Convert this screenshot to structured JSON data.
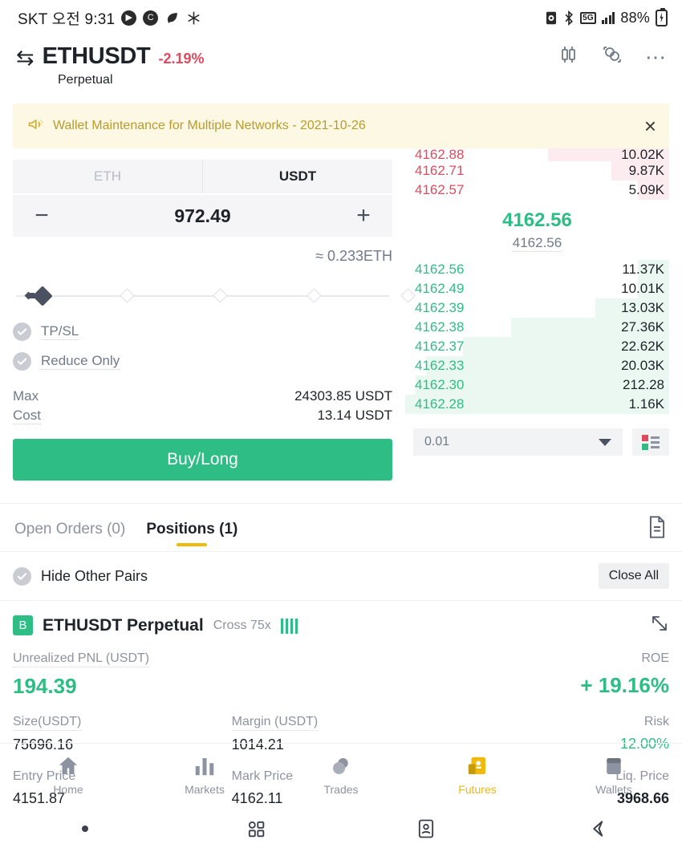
{
  "statusbar": {
    "carrier_time": "SKT 오전 9:31",
    "battery_percent": "88%",
    "network": "5G"
  },
  "header": {
    "swap_icon": "swap-icon",
    "pair": "ETHUSDT",
    "change": "-2.19%",
    "change_color": "#e04a5f",
    "subtitle": "Perpetual",
    "icons": [
      "candlestick-chart-icon",
      "orderbook-depth-icon",
      "more-options-icon"
    ]
  },
  "banner": {
    "icon": "announcement-icon",
    "text": "Wallet Maintenance for Multiple Networks - 2021-10-26",
    "close_label": "×",
    "bg_color": "#fdf8e3",
    "text_color": "#b99b2d"
  },
  "order_form": {
    "currency_tabs": [
      {
        "label": "ETH",
        "active": false
      },
      {
        "label": "USDT",
        "active": true
      }
    ],
    "minus_label": "−",
    "plus_label": "+",
    "quantity": "972.49",
    "approx": "≈ 0.233ETH",
    "slider_percent": 6,
    "checkboxes": [
      {
        "label": "TP/SL",
        "checked": true
      },
      {
        "label": "Reduce Only",
        "checked": true
      }
    ],
    "summary": [
      {
        "label": "Max",
        "value": "24303.85 USDT"
      },
      {
        "label": "Cost",
        "value": "13.14 USDT"
      }
    ],
    "submit_label": "Buy/Long",
    "submit_color": "#2ebd85"
  },
  "orderbook": {
    "asks": [
      {
        "price": "4162.88",
        "size": "10.02K",
        "depth": 46,
        "clipped": true
      },
      {
        "price": "4162.71",
        "size": "9.87K",
        "depth": 22
      },
      {
        "price": "4162.57",
        "size": "5.09K",
        "depth": 12
      }
    ],
    "mid_price": "4162.56",
    "mark_price": "4162.56",
    "bids": [
      {
        "price": "4162.56",
        "size": "11.37K",
        "depth": 12
      },
      {
        "price": "4162.49",
        "size": "10.01K",
        "depth": 12
      },
      {
        "price": "4162.39",
        "size": "13.03K",
        "depth": 28
      },
      {
        "price": "4162.38",
        "size": "27.36K",
        "depth": 60
      },
      {
        "price": "4162.37",
        "size": "22.62K",
        "depth": 78
      },
      {
        "price": "4162.33",
        "size": "20.03K",
        "depth": 92
      },
      {
        "price": "4162.30",
        "size": "212.28",
        "depth": 96
      },
      {
        "price": "4162.28",
        "size": "1.16K",
        "depth": 100
      }
    ],
    "tick_size": "0.01",
    "layout_icon": "orderbook-layout-icon",
    "ask_color": "#e04a5f",
    "bid_color": "#2ebd85"
  },
  "tabs": {
    "items": [
      {
        "label": "Open Orders (0)",
        "active": false
      },
      {
        "label": "Positions (1)",
        "active": true
      }
    ],
    "doc_icon": "order-history-icon",
    "indicator_color": "#f0b90b"
  },
  "hidebar": {
    "checkbox_label": "Hide Other Pairs",
    "checked": true,
    "close_all_label": "Close All"
  },
  "position": {
    "badge": "B",
    "title": "ETHUSDT Perpetual",
    "leverage": "Cross 75x",
    "risk_bars": 4,
    "external_icon": "open-external-icon",
    "pnl_label": "Unrealized PNL (USDT)",
    "pnl_value": "194.39",
    "roe_label": "ROE",
    "roe_value": "+ 19.16%",
    "fields": [
      {
        "label": "Size(USDT)",
        "value": "75696.16",
        "align": "left",
        "color": "default"
      },
      {
        "label": "Margin (USDT)",
        "value": "1014.21",
        "align": "left",
        "color": "default"
      },
      {
        "label": "Risk",
        "value": "12.00%",
        "align": "right",
        "color": "green"
      },
      {
        "label": "Entry Price",
        "value": "4151.87",
        "align": "left",
        "color": "default"
      },
      {
        "label": "Mark Price",
        "value": "4162.11",
        "align": "left",
        "color": "default"
      },
      {
        "label": "Liq. Price",
        "value": "3968.66",
        "align": "right",
        "color": "bold"
      }
    ],
    "green": "#2ebd85"
  },
  "bottom_nav": {
    "items": [
      {
        "label": "Home",
        "icon": "home-icon",
        "active": false
      },
      {
        "label": "Markets",
        "icon": "markets-bars-icon",
        "active": false
      },
      {
        "label": "Trades",
        "icon": "trades-icon",
        "active": false
      },
      {
        "label": "Futures",
        "icon": "futures-icon",
        "active": true
      },
      {
        "label": "Wallets",
        "icon": "wallets-icon",
        "active": false
      }
    ],
    "active_color": "#f0b90b"
  },
  "system_nav": {
    "items": [
      "dot-indicator",
      "recents-icon",
      "home-card-icon",
      "back-icon"
    ]
  }
}
